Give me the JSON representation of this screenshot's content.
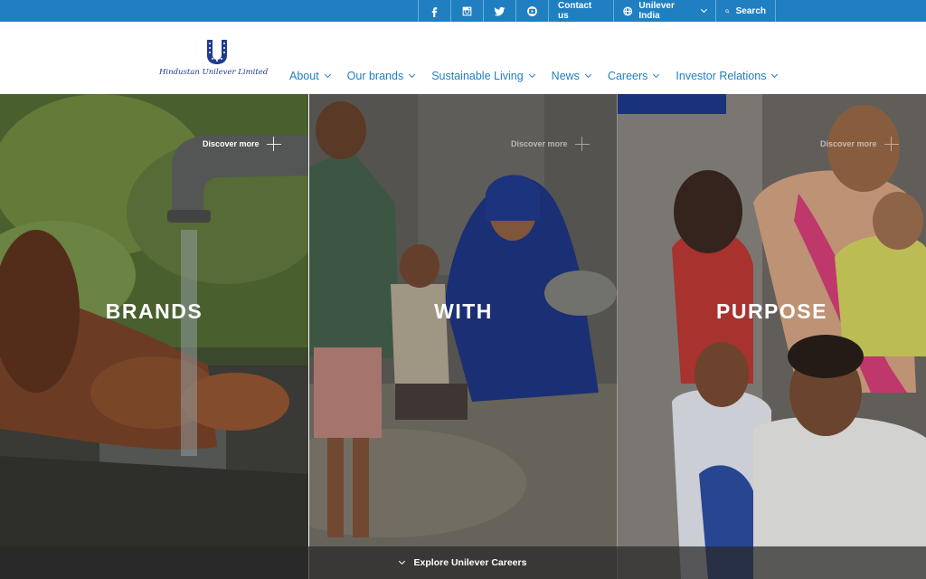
{
  "topbar": {
    "social": [
      "facebook-icon",
      "instagram-icon",
      "twitter-icon",
      "youtube-icon"
    ],
    "contact_label": "Contact us",
    "region_label": "Unilever India",
    "search_label": "Search",
    "background": "#1f7fc0"
  },
  "header": {
    "logo_text": "Hindustan Unilever Limited",
    "nav": [
      "About",
      "Our brands",
      "Sustainable Living",
      "News",
      "Careers",
      "Investor Relations"
    ],
    "accent": "#1f7fc0"
  },
  "hero": {
    "panels": [
      {
        "discover": "Discover more",
        "headline": "BRANDS"
      },
      {
        "discover": "Discover more",
        "headline": "WITH"
      },
      {
        "discover": "Discover more",
        "headline": "PURPOSE"
      }
    ],
    "explore_label": "Explore Unilever Careers"
  }
}
